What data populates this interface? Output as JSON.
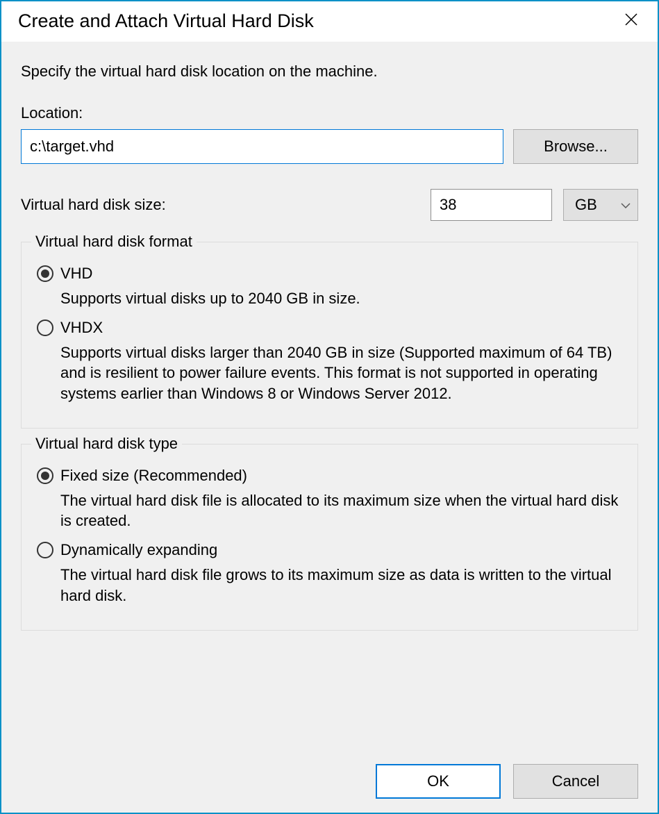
{
  "title": "Create and Attach Virtual Hard Disk",
  "instruction": "Specify the virtual hard disk location on the machine.",
  "location": {
    "label": "Location:",
    "value": "c:\\target.vhd",
    "browse": "Browse..."
  },
  "size": {
    "label": "Virtual hard disk size:",
    "value": "38",
    "unit": "GB"
  },
  "format": {
    "title": "Virtual hard disk format",
    "options": [
      {
        "label": "VHD",
        "desc": "Supports virtual disks up to 2040 GB in size.",
        "checked": true
      },
      {
        "label": "VHDX",
        "desc": "Supports virtual disks larger than 2040 GB in size (Supported maximum of 64 TB) and is resilient to power failure events. This format is not supported in operating systems earlier than Windows 8 or Windows Server 2012.",
        "checked": false
      }
    ]
  },
  "type": {
    "title": "Virtual hard disk type",
    "options": [
      {
        "label": "Fixed size (Recommended)",
        "desc": "The virtual hard disk file is allocated to its maximum size when the virtual hard disk is created.",
        "checked": true
      },
      {
        "label": "Dynamically expanding",
        "desc": "The virtual hard disk file grows to its maximum size as data is written to the virtual hard disk.",
        "checked": false
      }
    ]
  },
  "buttons": {
    "ok": "OK",
    "cancel": "Cancel"
  }
}
